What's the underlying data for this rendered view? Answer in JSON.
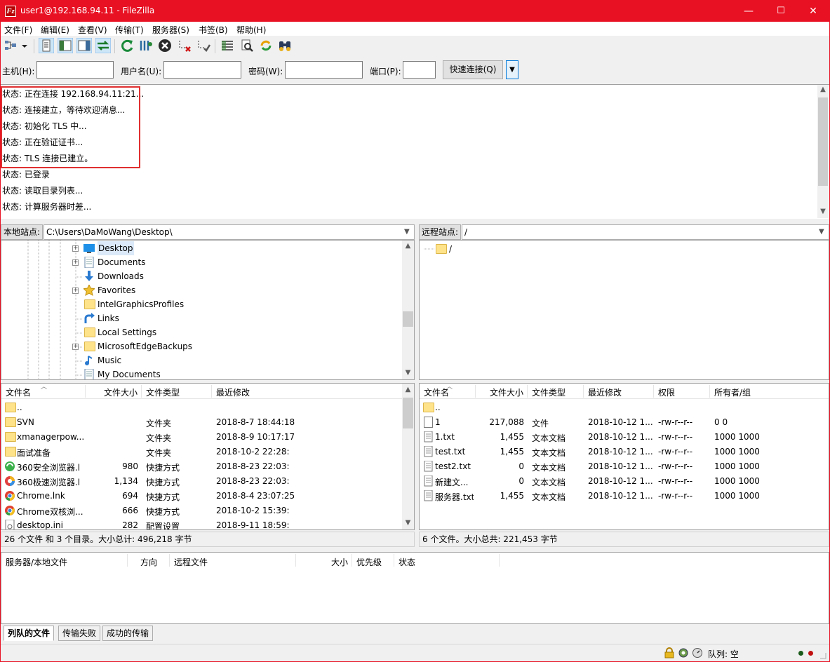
{
  "window": {
    "title": "user1@192.168.94.11 - FileZilla",
    "app_icon": "Fz",
    "min": "—",
    "max": "☐",
    "close": "✕"
  },
  "menu": [
    "文件(F)",
    "编辑(E)",
    "查看(V)",
    "传输(T)",
    "服务器(S)",
    "书签(B)",
    "帮助(H)"
  ],
  "quickconnect": {
    "host_label": "主机(H):",
    "host_value": "",
    "user_label": "用户名(U):",
    "user_value": "",
    "pass_label": "密码(W):",
    "pass_value": "",
    "port_label": "端口(P):",
    "port_value": "",
    "button": "快速连接(Q)"
  },
  "log": [
    "状态: 正在连接 192.168.94.11:21...",
    "状态: 连接建立，等待欢迎消息...",
    "状态: 初始化 TLS 中...",
    "状态: 正在验证证书...",
    "状态: TLS 连接已建立。",
    "状态: 已登录",
    "状态: 读取目录列表...",
    "状态: 计算服务器时差..."
  ],
  "local": {
    "label": "本地站点:",
    "path": "C:\\Users\\DaMoWang\\Desktop\\",
    "tree": [
      "Desktop",
      "Documents",
      "Downloads",
      "Favorites",
      "IntelGraphicsProfiles",
      "Links",
      "Local Settings",
      "MicrosoftEdgeBackups",
      "Music",
      "My Documents"
    ],
    "headers": [
      "文件名",
      "文件大小",
      "文件类型",
      "最近修改"
    ],
    "files": [
      {
        "name": "..",
        "size": "",
        "type": "",
        "mod": ""
      },
      {
        "name": "SVN",
        "size": "",
        "type": "文件夹",
        "mod": "2018-8-7 18:44:18"
      },
      {
        "name": "xmanagerpow...",
        "size": "",
        "type": "文件夹",
        "mod": "2018-8-9 10:17:17"
      },
      {
        "name": "面试准备",
        "size": "",
        "type": "文件夹",
        "mod": "2018-10-2 22:28:"
      },
      {
        "name": "360安全浏览器.l",
        "size": "980",
        "type": "快捷方式",
        "mod": "2018-8-23 22:03:"
      },
      {
        "name": "360极速浏览器.l",
        "size": "1,134",
        "type": "快捷方式",
        "mod": "2018-8-23 22:03:"
      },
      {
        "name": "Chrome.lnk",
        "size": "694",
        "type": "快捷方式",
        "mod": "2018-8-4 23:07:25"
      },
      {
        "name": "Chrome双核浏...",
        "size": "666",
        "type": "快捷方式",
        "mod": "2018-10-2 15:39:"
      },
      {
        "name": "desktop.ini",
        "size": "282",
        "type": "配置设置",
        "mod": "2018-9-11 18:59:"
      }
    ],
    "summary": "26 个文件 和 3 个目录。大小总计: 496,218 字节"
  },
  "remote": {
    "label": "远程站点:",
    "path": "/",
    "tree": [
      "/"
    ],
    "headers": [
      "文件名",
      "文件大小",
      "文件类型",
      "最近修改",
      "权限",
      "所有者/组"
    ],
    "files": [
      {
        "name": "..",
        "size": "",
        "type": "",
        "mod": "",
        "perm": "",
        "owner": ""
      },
      {
        "name": "1",
        "size": "217,088",
        "type": "文件",
        "mod": "2018-10-12 1...",
        "perm": "-rw-r--r--",
        "owner": "0 0"
      },
      {
        "name": "1.txt",
        "size": "1,455",
        "type": "文本文档",
        "mod": "2018-10-12 1...",
        "perm": "-rw-r--r--",
        "owner": "1000 1000"
      },
      {
        "name": "test.txt",
        "size": "1,455",
        "type": "文本文档",
        "mod": "2018-10-12 1...",
        "perm": "-rw-r--r--",
        "owner": "1000 1000"
      },
      {
        "name": "test2.txt",
        "size": "0",
        "type": "文本文档",
        "mod": "2018-10-12 1...",
        "perm": "-rw-r--r--",
        "owner": "1000 1000"
      },
      {
        "name": "新建文...",
        "size": "0",
        "type": "文本文档",
        "mod": "2018-10-12 1...",
        "perm": "-rw-r--r--",
        "owner": "1000 1000"
      },
      {
        "name": "服务器.txt",
        "size": "1,455",
        "type": "文本文档",
        "mod": "2018-10-12 1...",
        "perm": "-rw-r--r--",
        "owner": "1000 1000"
      }
    ],
    "summary": "6 个文件。大小总共: 221,453 字节"
  },
  "queue": {
    "headers": [
      "服务器/本地文件",
      "方向",
      "远程文件",
      "大小",
      "优先级",
      "状态"
    ]
  },
  "tabs": [
    "列队的文件",
    "传输失败",
    "成功的传输"
  ],
  "statusbar": {
    "queue": "队列: 空"
  }
}
